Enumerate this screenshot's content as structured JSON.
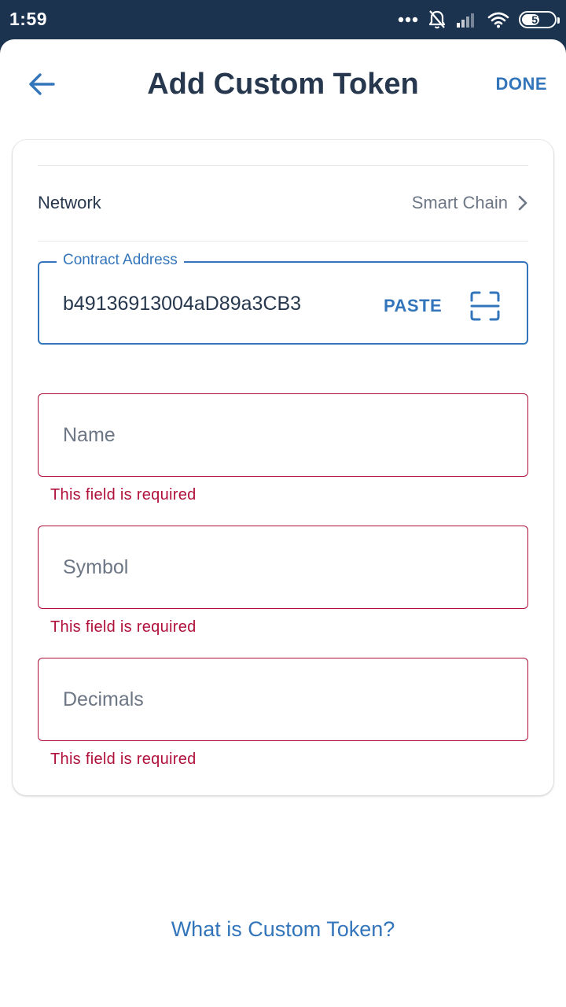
{
  "status_bar": {
    "time": "1:59",
    "battery_level": "51",
    "icons": [
      "more-dots-icon",
      "bell-off-icon",
      "signal-icon",
      "wifi-icon",
      "battery-icon"
    ]
  },
  "header": {
    "back_icon": "arrow-left-icon",
    "title": "Add Custom Token",
    "done_label": "DONE"
  },
  "form": {
    "network": {
      "label": "Network",
      "value": "Smart Chain",
      "icon": "chevron-right-icon"
    },
    "contract_address": {
      "label": "Contract Address",
      "value": "b49136913004aD89a3CB3",
      "paste_label": "PASTE",
      "scan_icon": "scan-icon"
    },
    "name": {
      "placeholder": "Name",
      "error": "This field is required"
    },
    "symbol": {
      "placeholder": "Symbol",
      "error": "This field is required"
    },
    "decimals": {
      "placeholder": "Decimals",
      "error": "This field is required"
    }
  },
  "help_link": "What is Custom Token?",
  "colors": {
    "accent": "#3375bb",
    "title": "#27384e",
    "muted": "#6c7684",
    "error": "#b0103a",
    "status_bar": "#1c3350"
  }
}
